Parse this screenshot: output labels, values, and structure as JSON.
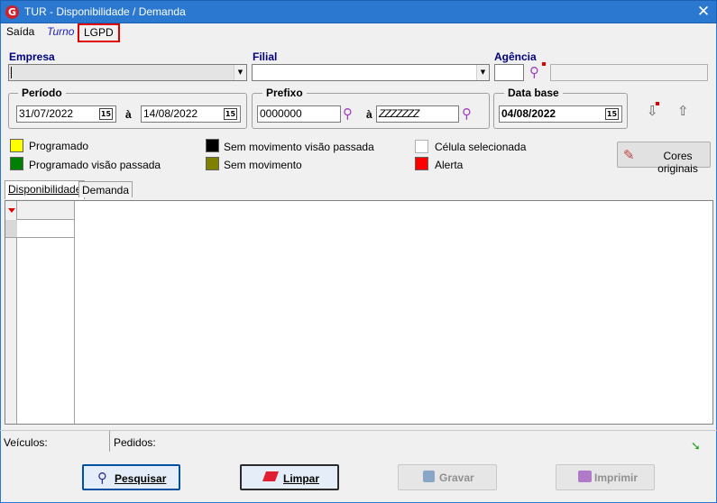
{
  "window": {
    "title": "TUR - Disponibilidade / Demanda",
    "app_icon": "G",
    "close_glyph": "✕"
  },
  "menu": {
    "items": [
      "Saída",
      "Turno",
      "LGPD"
    ]
  },
  "filters": {
    "empresa_label": "Empresa",
    "empresa_value": "",
    "filial_label": "Filial",
    "filial_value": "",
    "agencia_label": "Agência",
    "agencia_code": "",
    "agencia_name": ""
  },
  "periodo": {
    "label": "Período",
    "from": "31/07/2022",
    "sep": "à",
    "to": "14/08/2022",
    "cal_icon_text": "15"
  },
  "prefixo": {
    "label": "Prefixo",
    "from": "0000000",
    "sep": "à",
    "to": "ZZZZZZZ"
  },
  "data_base": {
    "label": "Data base",
    "value": "04/08/2022"
  },
  "legend": [
    {
      "label": "Programado",
      "color": "#ffff00"
    },
    {
      "label": "Programado visão passada",
      "color": "#008000"
    },
    {
      "label": "Sem movimento visão passada",
      "color": "#000000"
    },
    {
      "label": "Sem movimento",
      "color": "#808000"
    },
    {
      "label": "Célula selecionada",
      "color": "#ffffff"
    },
    {
      "label": "Alerta",
      "color": "#ff0000"
    }
  ],
  "cores_button": "Cores originais",
  "tabs": [
    "Disponibilidade",
    "Demanda"
  ],
  "status": {
    "veiculos_label": "Veículos:",
    "pedidos_label": "Pedidos:"
  },
  "buttons": {
    "pesquisar": "Pesquisar",
    "limpar": "Limpar",
    "gravar": "Gravar",
    "imprimir": "Imprimir"
  },
  "colors": {
    "titlebar": "#2b78d0",
    "highlight_border": "#e00000",
    "label_blue": "#000080"
  }
}
